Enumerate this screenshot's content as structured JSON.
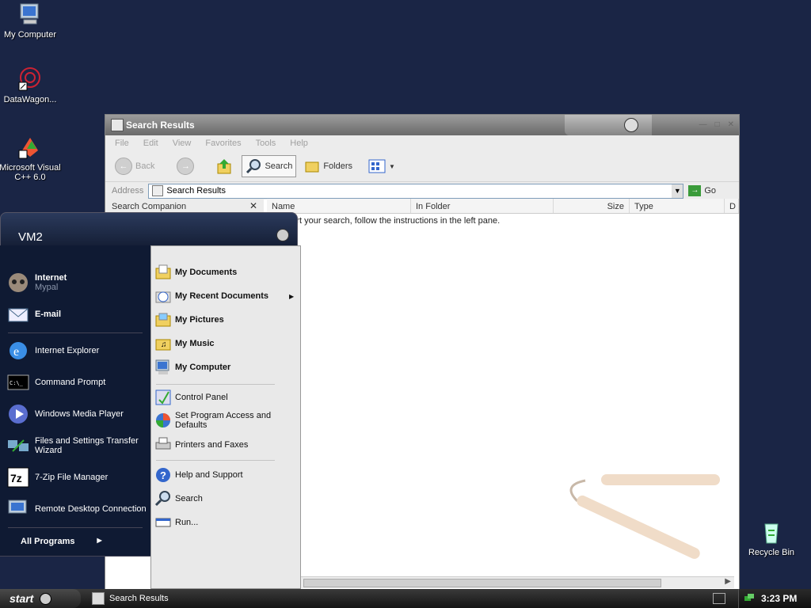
{
  "desktop": {
    "icons": [
      {
        "label": "My Computer",
        "icon": "my-computer-icon"
      },
      {
        "label": "DataWagon...",
        "icon": "datawagon-icon"
      },
      {
        "label": "Microsoft Visual C++ 6.0",
        "icon": "visual-cpp-icon"
      },
      {
        "label": "Recycle Bin",
        "icon": "recycle-bin-icon"
      }
    ]
  },
  "window": {
    "title": "Search Results",
    "menu": [
      "File",
      "Edit",
      "View",
      "Favorites",
      "Tools",
      "Help"
    ],
    "toolbar": {
      "back": "Back",
      "search": "Search",
      "folders": "Folders"
    },
    "address": {
      "label": "Address",
      "value": "Search Results",
      "go": "Go"
    },
    "companion": {
      "title": "Search Companion",
      "close": "✕"
    },
    "columns": [
      "Name",
      "In Folder",
      "Size",
      "Type",
      "D"
    ],
    "message": "To start your search, follow the instructions in the left pane."
  },
  "start_menu": {
    "user": "VM2",
    "pinned": [
      {
        "label": "Internet",
        "sub": "Mypal",
        "icon": "mypal-icon"
      },
      {
        "label": "E-mail",
        "icon": "email-icon"
      }
    ],
    "recent": [
      {
        "label": "Internet Explorer",
        "icon": "internet-explorer-icon"
      },
      {
        "label": "Command Prompt",
        "icon": "command-prompt-icon"
      },
      {
        "label": "Windows Media Player",
        "icon": "media-player-icon"
      },
      {
        "label": "Files and Settings Transfer Wizard",
        "icon": "transfer-wizard-icon"
      },
      {
        "label": "7-Zip File Manager",
        "icon": "7zip-icon"
      },
      {
        "label": "Remote Desktop Connection",
        "icon": "remote-desktop-icon"
      }
    ],
    "all_programs": "All Programs",
    "right_top": [
      {
        "label": "My Documents",
        "icon": "my-documents-icon"
      },
      {
        "label": "My Recent Documents",
        "icon": "recent-documents-icon"
      },
      {
        "label": "My Pictures",
        "icon": "my-pictures-icon"
      },
      {
        "label": "My Music",
        "icon": "my-music-icon"
      },
      {
        "label": "My Computer",
        "icon": "my-computer-icon"
      }
    ],
    "right_mid": [
      {
        "label": "Control Panel",
        "icon": "control-panel-icon"
      },
      {
        "label": "Set Program Access and Defaults",
        "icon": "program-access-icon"
      },
      {
        "label": "Printers and Faxes",
        "icon": "printer-icon"
      }
    ],
    "right_bottom": [
      {
        "label": "Help and Support",
        "icon": "help-icon"
      },
      {
        "label": "Search",
        "icon": "search-icon"
      },
      {
        "label": "Run...",
        "icon": "run-icon"
      }
    ]
  },
  "taskbar": {
    "start": "start",
    "task": "Search Results",
    "clock": "3:23 PM"
  }
}
